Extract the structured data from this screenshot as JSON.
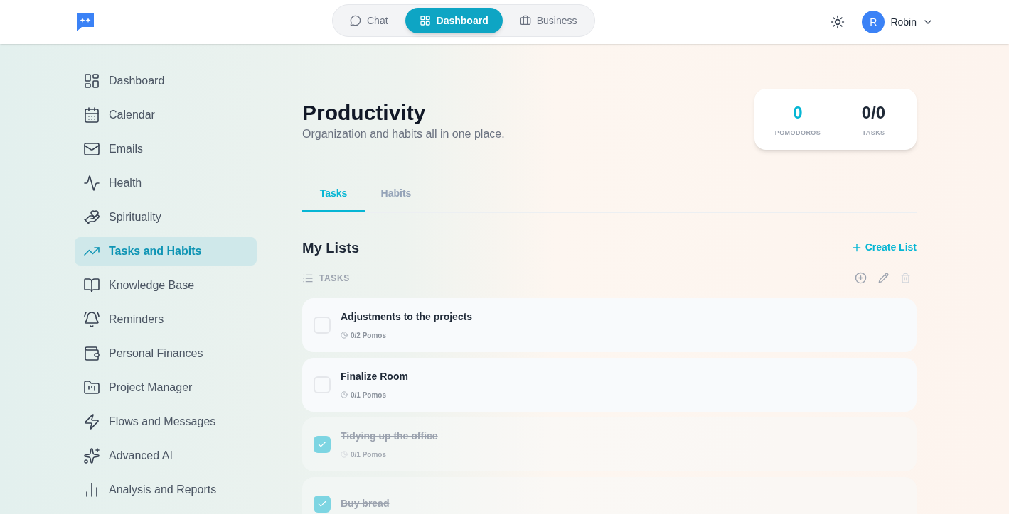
{
  "top_nav": {
    "tabs": [
      {
        "label": "Chat",
        "selected": false
      },
      {
        "label": "Dashboard",
        "selected": true
      },
      {
        "label": "Business",
        "selected": false
      }
    ],
    "user": {
      "initial": "R",
      "name": "Robin"
    }
  },
  "sidebar": {
    "items": [
      {
        "label": "Dashboard",
        "selected": false
      },
      {
        "label": "Calendar",
        "selected": false
      },
      {
        "label": "Emails",
        "selected": false
      },
      {
        "label": "Health",
        "selected": false
      },
      {
        "label": "Spirituality",
        "selected": false
      },
      {
        "label": "Tasks and Habits",
        "selected": true
      },
      {
        "label": "Knowledge Base",
        "selected": false
      },
      {
        "label": "Reminders",
        "selected": false
      },
      {
        "label": "Personal Finances",
        "selected": false
      },
      {
        "label": "Project Manager",
        "selected": false
      },
      {
        "label": "Flows and Messages",
        "selected": false
      },
      {
        "label": "Advanced AI",
        "selected": false
      },
      {
        "label": "Analysis and Reports",
        "selected": false
      }
    ]
  },
  "header": {
    "title": "Productivity",
    "subtitle": "Organization and habits all in one place."
  },
  "stats": [
    {
      "value": "0",
      "label": "POMODOROS"
    },
    {
      "value": "0/0",
      "label": "TASKS"
    }
  ],
  "tabs": [
    {
      "label": "Tasks",
      "selected": true
    },
    {
      "label": "Habits",
      "selected": false
    }
  ],
  "lists": {
    "title": "My Lists",
    "create_button": "Create List",
    "list_name": "TASKS",
    "tasks": [
      {
        "title": "Adjustments to the projects",
        "pomos": "0/2 Pomos",
        "checked": false
      },
      {
        "title": "Finalize Room",
        "pomos": "0/1 Pomos",
        "checked": false
      },
      {
        "title": "Tidying up the office",
        "pomos": "0/1 Pomos",
        "checked": true
      },
      {
        "title": "Buy bread",
        "checked": true
      }
    ]
  }
}
